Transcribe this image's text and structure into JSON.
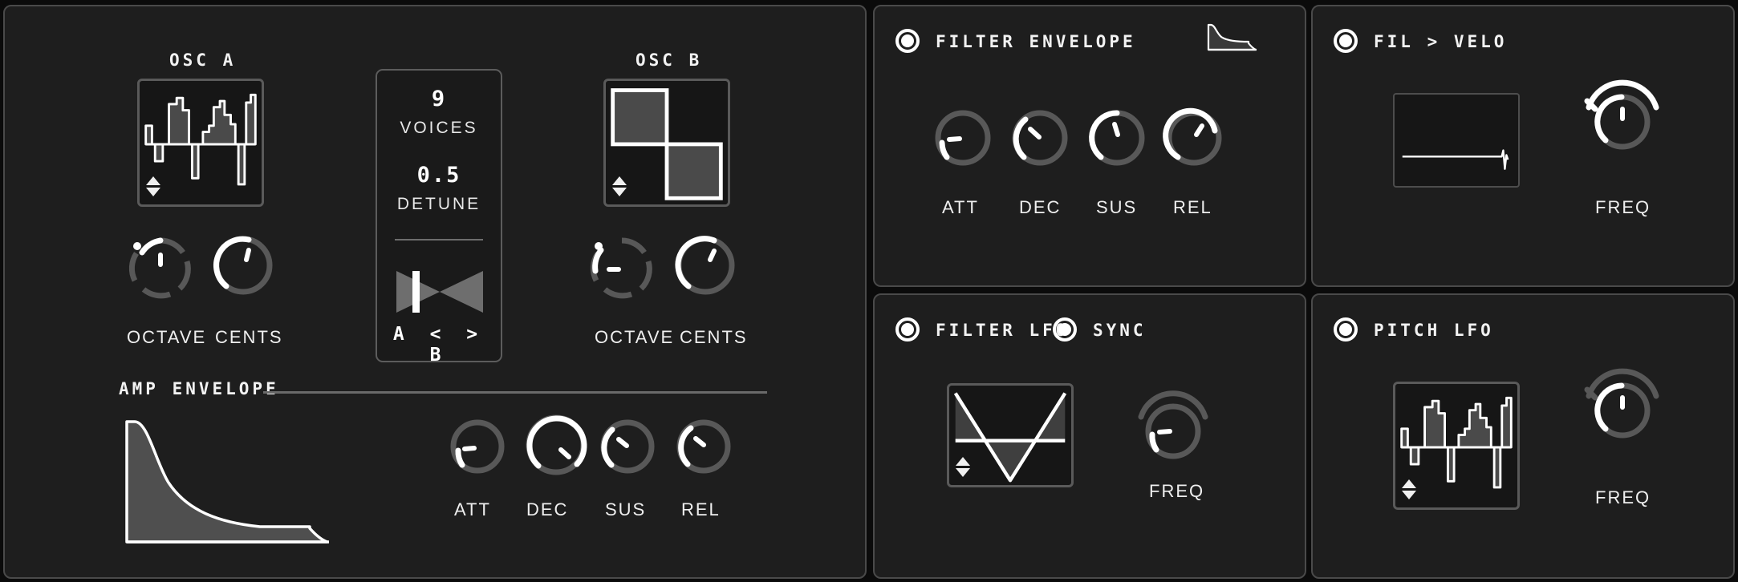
{
  "theme": {
    "background": "#0b0b0b",
    "panel_bg": "#1e1e1e",
    "panel_border": "#4a4a4a",
    "accent": "#ffffff",
    "track": "#5a5a5a"
  },
  "osc_panel": {
    "osc_a": {
      "title": "OSC A",
      "wave_name": "complex-stepped-wave",
      "octave": {
        "label": "OCTAVE",
        "type": "stepped"
      },
      "cents": {
        "label": "CENTS",
        "type": "continuous"
      }
    },
    "osc_b": {
      "title": "OSC B",
      "wave_name": "square-wave",
      "octave": {
        "label": "OCTAVE",
        "type": "stepped"
      },
      "cents": {
        "label": "CENTS",
        "type": "continuous"
      }
    },
    "voices_module": {
      "voices_value": "9",
      "voices_label": "VOICES",
      "detune_value": "0.5",
      "detune_label": "DETUNE",
      "crossfade_label": "A < > B",
      "crossfade_a": "A",
      "crossfade_left_arrow": "<",
      "crossfade_right_arrow": ">",
      "crossfade_b": "B"
    },
    "amp_envelope": {
      "title": "AMP ENVELOPE",
      "knobs": [
        {
          "label": "ATT"
        },
        {
          "label": "DEC"
        },
        {
          "label": "SUS"
        },
        {
          "label": "REL"
        }
      ]
    }
  },
  "filter_envelope": {
    "title": "FILTER ENVELOPE",
    "enabled": true,
    "thumbnail_name": "envelope-thumbnail",
    "knobs": [
      {
        "label": "ATT"
      },
      {
        "label": "DEC"
      },
      {
        "label": "SUS"
      },
      {
        "label": "REL"
      }
    ]
  },
  "fil_velo": {
    "title": "FIL > VELO",
    "enabled": true,
    "display_name": "velocity-curve-display",
    "freq": {
      "label": "FREQ"
    }
  },
  "filter_lfo": {
    "title": "FILTER LFO",
    "enabled": true,
    "sync_title": "SYNC",
    "sync_enabled": true,
    "wave_name": "triangle-wave",
    "freq": {
      "label": "FREQ"
    }
  },
  "pitch_lfo": {
    "title": "PITCH LFO",
    "enabled": true,
    "wave_name": "complex-stepped-wave",
    "freq": {
      "label": "FREQ"
    }
  },
  "chart_data": {
    "type": "line",
    "title": "AMP ENVELOPE",
    "xlabel": "",
    "ylabel": "",
    "series": [
      {
        "name": "amp-envelope-adsr",
        "points": [
          [
            0,
            0
          ],
          [
            0.5,
            100
          ],
          [
            3,
            100
          ],
          [
            8,
            72
          ],
          [
            18,
            52
          ],
          [
            32,
            38
          ],
          [
            48,
            31
          ],
          [
            66,
            27
          ],
          [
            82,
            25
          ],
          [
            88,
            25
          ],
          [
            91,
            12
          ],
          [
            94,
            2
          ],
          [
            97,
            0
          ],
          [
            100,
            0
          ]
        ]
      }
    ],
    "knob_values": {
      "amp": {
        "ATT": 0.12,
        "DEC": 0.72,
        "SUS": 0.34,
        "REL": 0.3
      },
      "filter": {
        "ATT": 0.05,
        "DEC": 0.28,
        "SUS": 0.5,
        "REL": 0.62
      }
    },
    "grid": false,
    "legend": false
  }
}
